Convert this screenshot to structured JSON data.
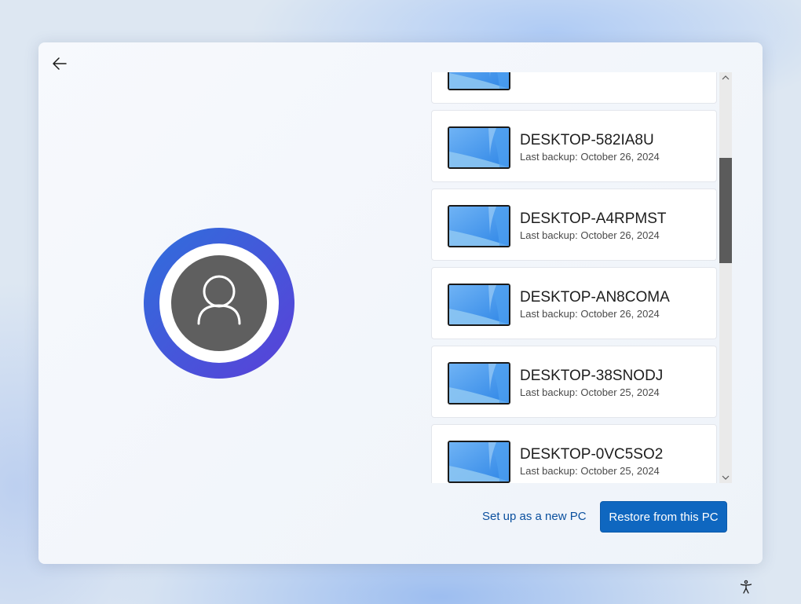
{
  "window": {
    "back_icon": "back-arrow-icon",
    "avatar_icon": "user-icon",
    "accessibility_icon": "accessibility-icon"
  },
  "devices": [
    {
      "name": "",
      "backup": ""
    },
    {
      "name": "DESKTOP-582IA8U",
      "backup": "Last backup: October 26, 2024"
    },
    {
      "name": "DESKTOP-A4RPMST",
      "backup": "Last backup: October 26, 2024"
    },
    {
      "name": "DESKTOP-AN8COMA",
      "backup": "Last backup: October 26, 2024"
    },
    {
      "name": "DESKTOP-38SNODJ",
      "backup": "Last backup: October 25, 2024"
    },
    {
      "name": "DESKTOP-0VC5SO2",
      "backup": "Last backup: October 25, 2024"
    },
    {
      "name": "",
      "backup": ""
    }
  ],
  "actions": {
    "setup_new_label": "Set up as a new PC",
    "restore_label": "Restore from this PC"
  },
  "colors": {
    "accent": "#0f67c0",
    "avatar_ring_start": "#2f6fdc",
    "avatar_ring_end": "#5a40d8",
    "avatar_fill": "#5f5f5f"
  }
}
